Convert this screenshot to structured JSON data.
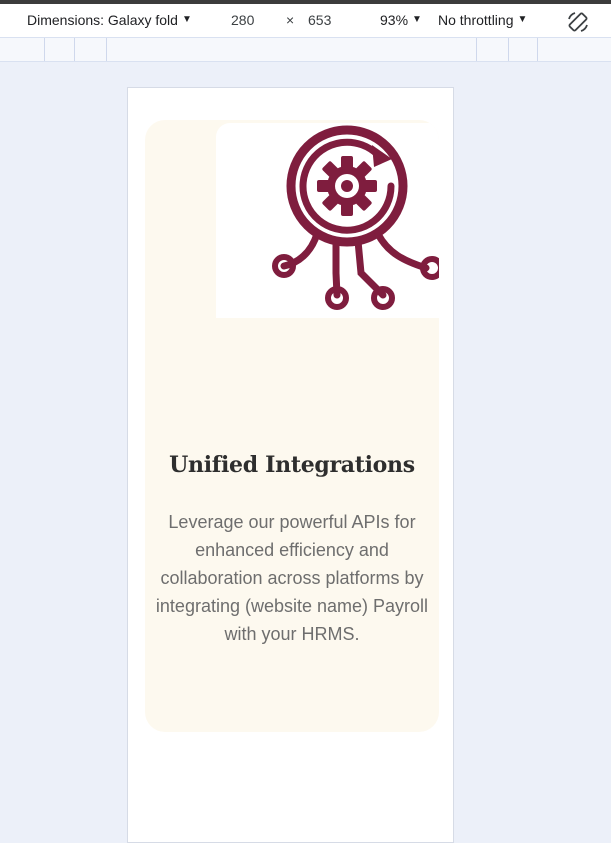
{
  "toolbar": {
    "dimensions_label": "Dimensions: Galaxy fold",
    "width": "280",
    "times": "×",
    "height": "653",
    "zoom": "93%",
    "throttling": "No throttling",
    "caret": "▼"
  },
  "card": {
    "title": "Unified Integrations",
    "description": "Leverage our powerful APIs for enhanced efficiency and collaboration across platforms by integrating (website name) Payroll with your HRMS.",
    "illustration_icon": "gear-integration-icon",
    "illustration_color": "#7f1d3e",
    "background_color": "#fdf9ef"
  }
}
